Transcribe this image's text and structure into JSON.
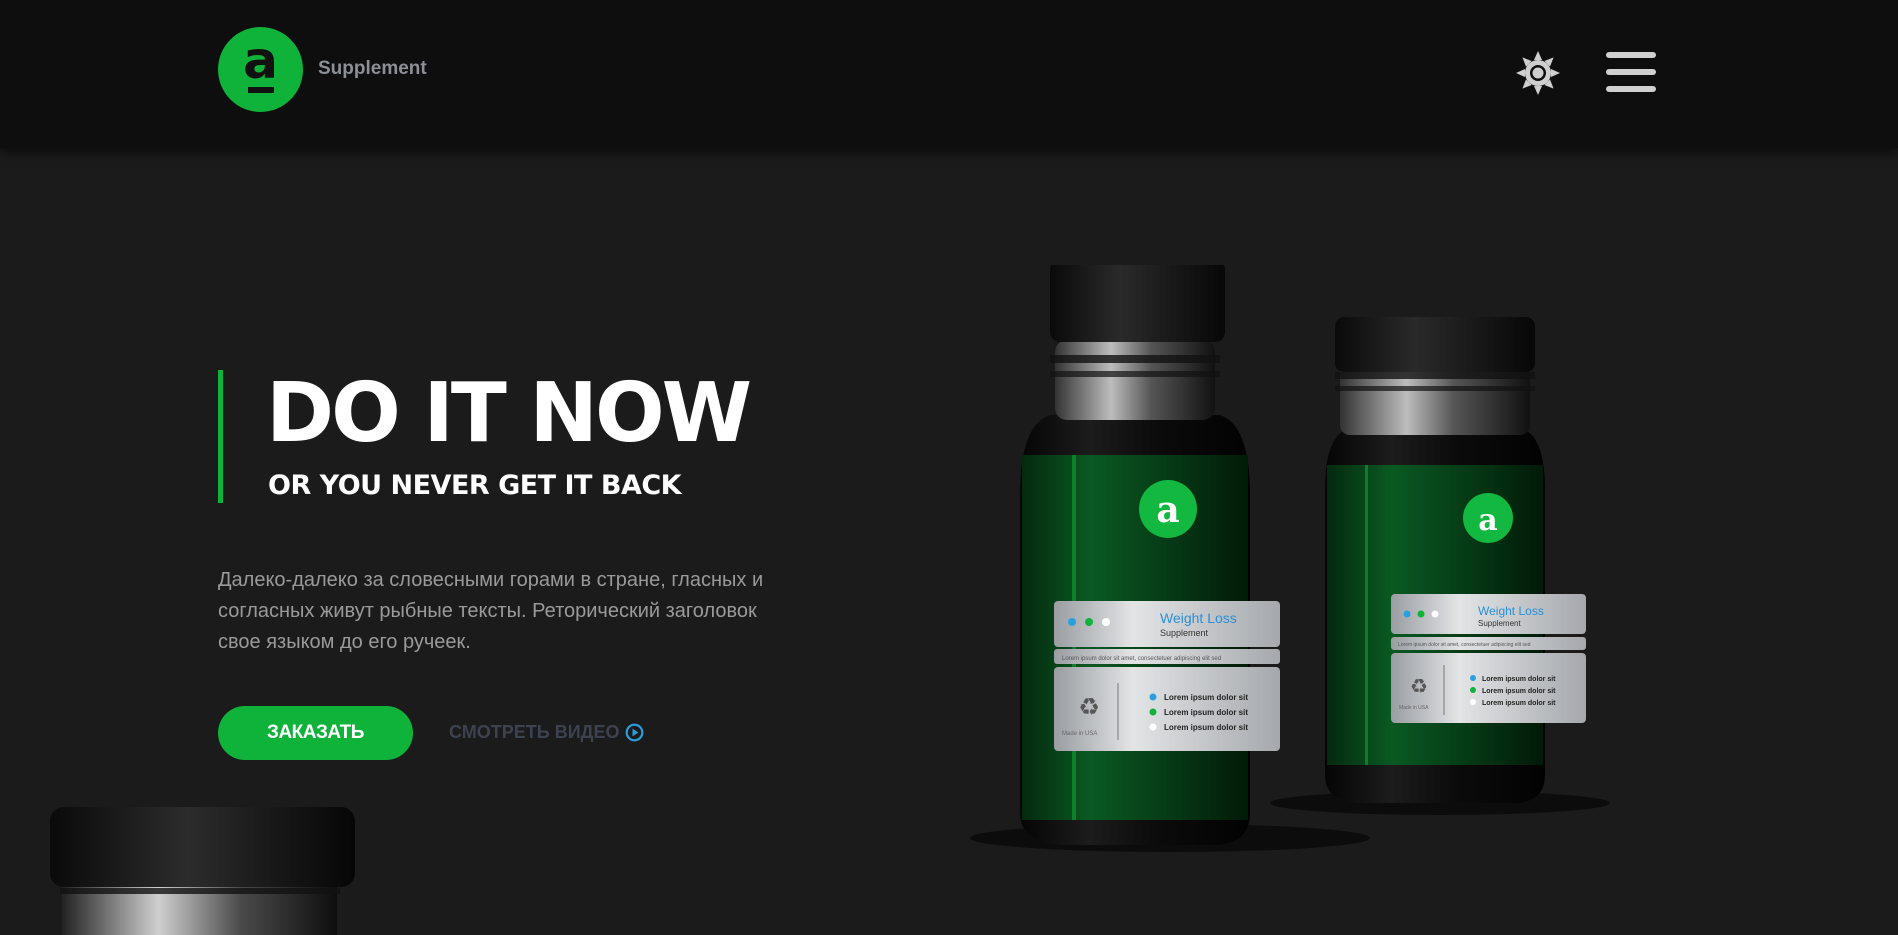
{
  "header": {
    "brand": "Supplement",
    "logo_letter": "a",
    "theme_icon": "sun-icon",
    "menu_icon": "hamburger-menu-icon"
  },
  "hero": {
    "title": "DO IT NOW",
    "subtitle": "OR YOU NEVER GET IT BACK",
    "description": "Далеко-далеко за словесными горами в стране, гласных и согласных живут рыбные тексты. Реторический заголовок свое языком до его ручеек.",
    "order_button": "ЗАКАЗАТЬ",
    "video_link": "СМОТРЕТЬ ВИДЕО",
    "video_icon": "play-circle-icon"
  },
  "product": {
    "label_title": "Weight Loss",
    "label_subtitle": "Supplement",
    "label_line": "Lorem ipsum dolor sit amet, consectetuer adipiscing elit sed",
    "label_bullets": [
      "Lorem ipsum dolor sit",
      "Lorem ipsum dolor sit",
      "Lorem ipsum dolor sit"
    ],
    "label_origin": "Made in USA",
    "recycle_icon": "recycle-icon"
  },
  "colors": {
    "accent": "#0fb33a",
    "background": "#1b1b1b",
    "header": "#0e0e0e",
    "label_blue": "#2a8fd6"
  }
}
